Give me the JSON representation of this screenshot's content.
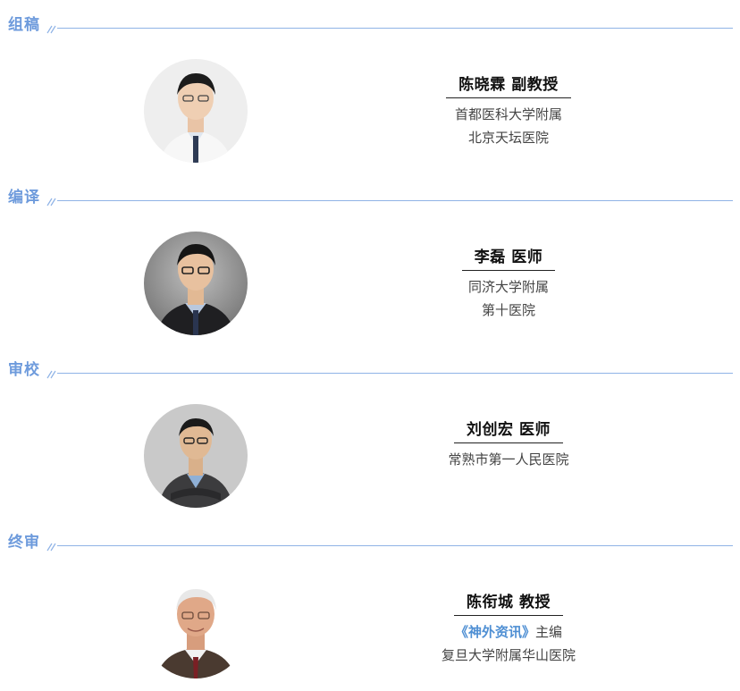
{
  "sections": [
    {
      "title": "组稿",
      "person": {
        "name": "陈晓霖 副教授",
        "lines": [
          "首都医科大学附属",
          "北京天坛医院"
        ]
      }
    },
    {
      "title": "编译",
      "person": {
        "name": "李磊 医师",
        "lines": [
          "同济大学附属",
          "第十医院"
        ]
      }
    },
    {
      "title": "审校",
      "person": {
        "name": "刘创宏 医师",
        "lines": [
          "常熟市第一人民医院"
        ]
      }
    },
    {
      "title": "终审",
      "person": {
        "name": "陈衔城 教授",
        "magazine": "《神外资讯》",
        "role": "主编",
        "lines": [
          "复旦大学附属华山医院"
        ]
      }
    }
  ],
  "colors": {
    "accent": "#6e9bdc",
    "magazine": "#4f8fd3"
  }
}
